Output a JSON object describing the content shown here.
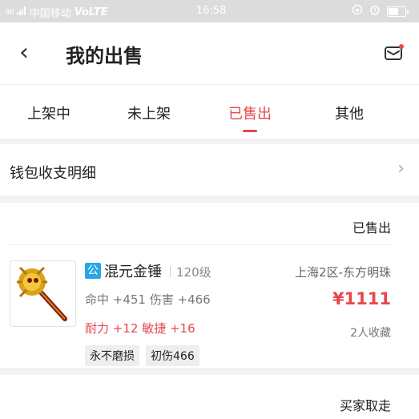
{
  "status_bar": {
    "signal": "46",
    "carrier": "中国移动",
    "volte": "VoLTE",
    "time": "16:58"
  },
  "header": {
    "back_icon": "‹",
    "title": "我的出售"
  },
  "tabs": [
    {
      "label": "上架中"
    },
    {
      "label": "未上架"
    },
    {
      "label": "已售出"
    },
    {
      "label": "其他"
    }
  ],
  "active_tab": "已售出",
  "wallet": {
    "label": "钱包收支明细",
    "chevron": "›"
  },
  "order1": {
    "status": "已售出",
    "badge": "公",
    "name": "混元金锤",
    "level": "120级",
    "server": "上海2区-东方明珠",
    "stats_line1": "命中 +451 伤害 +466",
    "stats_line2": "耐力 +12 敏捷 +16",
    "price": "¥1111",
    "favorites": "2人收藏",
    "tags": [
      "永不磨损",
      "初伤466"
    ]
  },
  "order2": {
    "status": "买家取走"
  },
  "colors": {
    "accent": "#e8474b",
    "badge_blue": "#28a6e8"
  }
}
